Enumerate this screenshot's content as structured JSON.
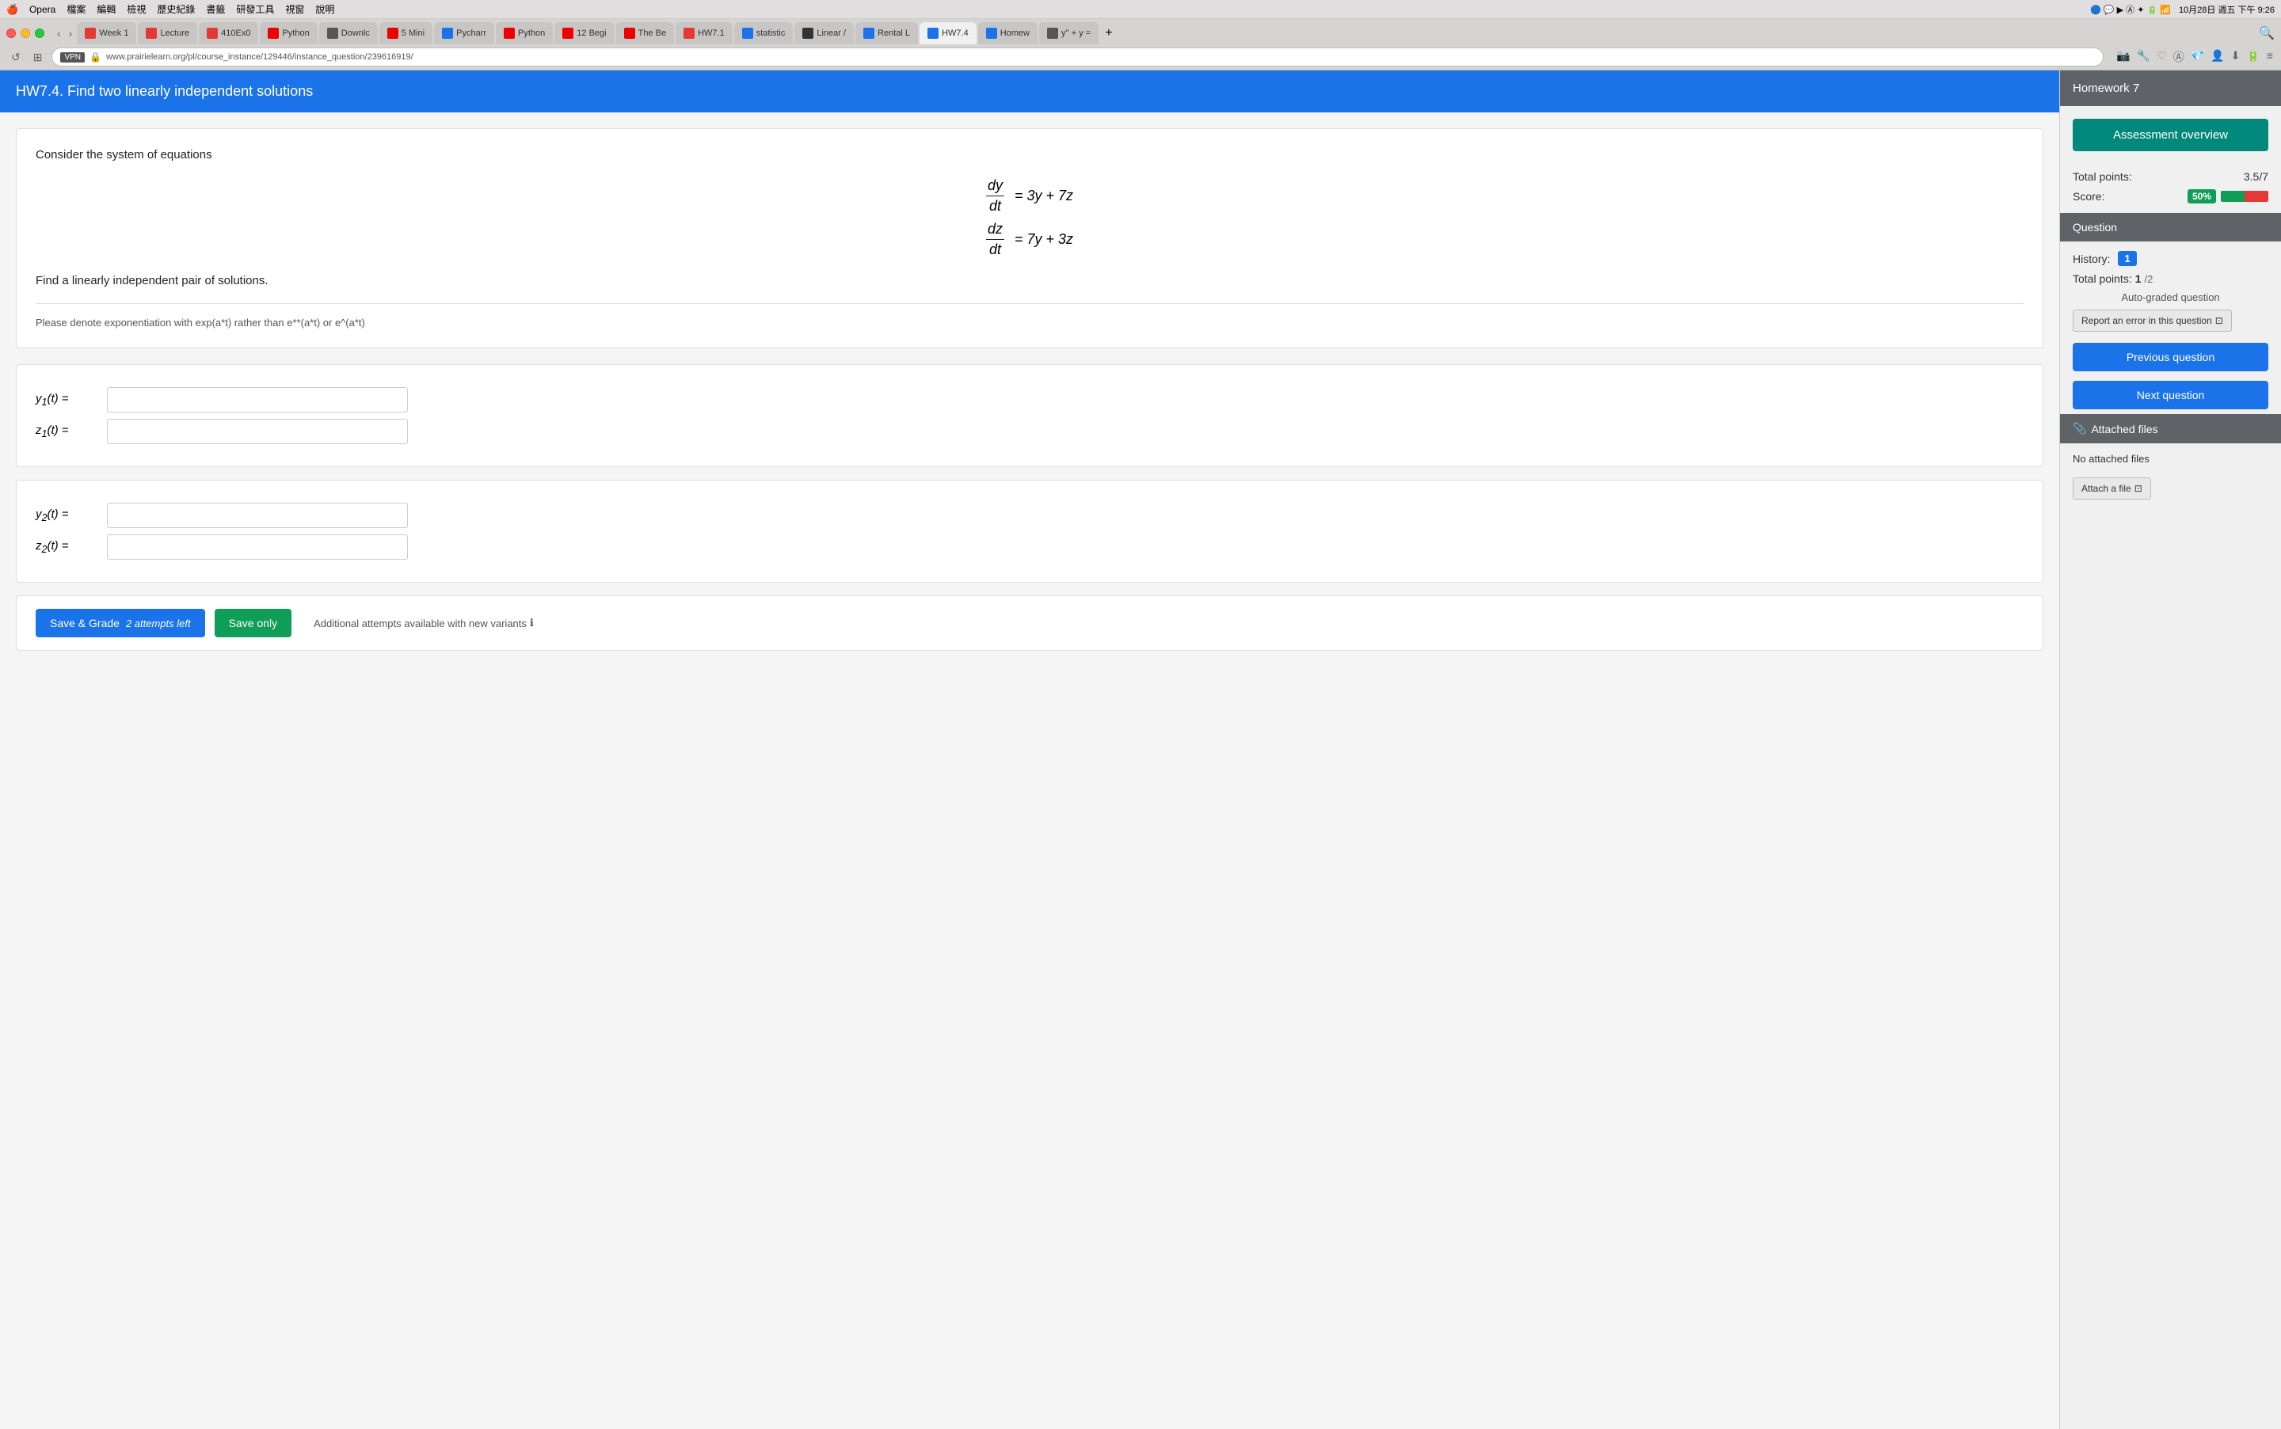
{
  "menubar": {
    "apple": "🍎",
    "items": [
      "Opera",
      "檔案",
      "編輯",
      "檢視",
      "歷史紀錄",
      "書籤",
      "研發工具",
      "視窗",
      "說明"
    ],
    "right_items": [
      "10月28日 週五 下午 9:26"
    ]
  },
  "tabs": [
    {
      "label": "Week 1",
      "color": "#e53935"
    },
    {
      "label": "Lecture",
      "color": "#e53935"
    },
    {
      "label": "410Ex0",
      "color": "#e53935"
    },
    {
      "label": "Python",
      "color": "#ff0000"
    },
    {
      "label": "Downlc",
      "color": "#555"
    },
    {
      "label": "5 Mini",
      "color": "#ff0000"
    },
    {
      "label": "Pycharr",
      "color": "#1a73e8"
    },
    {
      "label": "Python",
      "color": "#ff0000"
    },
    {
      "label": "12 Begi",
      "color": "#ff0000"
    },
    {
      "label": "The Be",
      "color": "#ff0000"
    },
    {
      "label": "HW7.1",
      "color": "#e53935"
    },
    {
      "label": "statistic",
      "color": "#1a73e8"
    },
    {
      "label": "Linear /",
      "color": "#333"
    },
    {
      "label": "Rental L",
      "color": "#1a73e8"
    },
    {
      "label": "HW7.4",
      "color": "#1a73e8",
      "active": true
    },
    {
      "label": "Homew",
      "color": "#1a73e8"
    },
    {
      "label": "y'' + y =",
      "color": "#555"
    }
  ],
  "address_bar": {
    "url": "www.prairielearn.org/pl/course_instance/129446/instance_question/239616919/",
    "vpn_label": "VPN"
  },
  "question_header": {
    "title": "HW7.4. Find two linearly independent solutions"
  },
  "question_body": {
    "intro_text": "Consider the system of equations",
    "equation1_lhs": "dy/dt",
    "equation1_rhs": "= 3y + 7z",
    "equation2_lhs": "dz/dt",
    "equation2_rhs": "= 7y + 3z",
    "find_text": "Find a linearly independent pair of solutions.",
    "note_text": "Please denote exponentiation with exp(a*t) rather than e**(a*t) or e^(a*t)"
  },
  "inputs": {
    "y1_label": "y₁(t) =",
    "z1_label": "z₁(t) =",
    "y2_label": "y₂(t) =",
    "z2_label": "z₂(t) ="
  },
  "action_bar": {
    "save_grade_label": "Save & Grade",
    "attempts_label": "2 attempts left",
    "save_only_label": "Save only",
    "additional_text": "Additional attempts available with new variants",
    "info_icon": "ℹ"
  },
  "sidebar": {
    "header_title": "Homework 7",
    "assessment_overview_label": "Assessment overview",
    "total_points_label": "Total points:",
    "total_points_value": "3.5/7",
    "score_label": "Score:",
    "score_percent": "50%",
    "score_fill": 50,
    "question_section_label": "Question",
    "history_label": "History:",
    "history_count": "1",
    "question_points_label": "Total points:",
    "question_points_value": "1",
    "question_points_total": "/2",
    "auto_grade_label": "Auto-graded question",
    "report_error_label": "Report an error in this question",
    "report_icon": "⊡",
    "prev_question_label": "Previous question",
    "next_question_label": "Next question",
    "attached_files_label": "Attached files",
    "paperclip_icon": "📎",
    "no_files_label": "No attached files",
    "attach_file_label": "Attach a file",
    "attach_icon": "⊡"
  }
}
